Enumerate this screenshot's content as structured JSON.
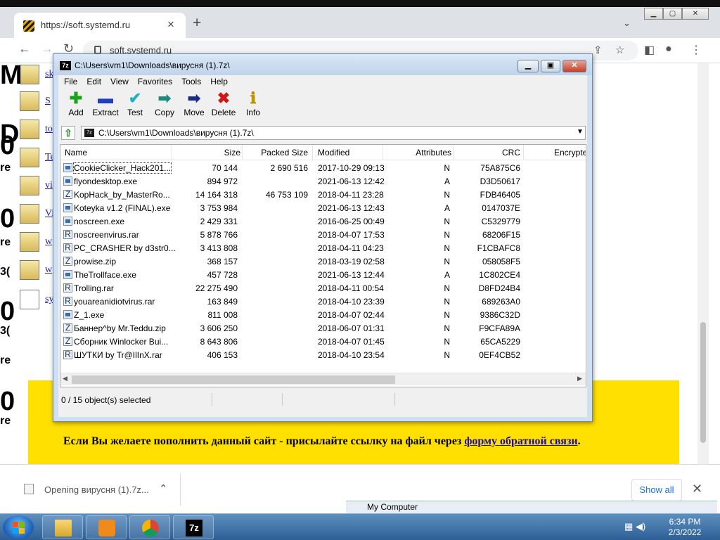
{
  "browser": {
    "tab_title": "https://soft.systemd.ru",
    "url": "soft.systemd.ru",
    "new_tab_symbol": "+",
    "close_symbol": "×"
  },
  "page": {
    "side_links": [
      "sk",
      "S",
      "to",
      "Te",
      "vi",
      "Vi",
      "w",
      "w",
      "sy"
    ],
    "big_left_chars": [
      "M",
      "D",
      "0",
      "re",
      "0",
      "re",
      "3(",
      "0",
      "3(",
      "re",
      "0",
      "re"
    ],
    "banner_text": "Если Вы желаете пополнить данный сайт - присылайте ссылку на файл через",
    "banner_link": "форму обратной связи",
    "banner_end": "."
  },
  "download_bar": {
    "item_text": "Opening вирусня (1).7z...",
    "show_all": "Show all"
  },
  "background_window": {
    "label": "My Computer"
  },
  "sevenzip": {
    "title": "C:\\Users\\vm1\\Downloads\\вирусня (1).7z\\",
    "logo": "7z",
    "menu": [
      "File",
      "Edit",
      "View",
      "Favorites",
      "Tools",
      "Help"
    ],
    "toolbar": [
      {
        "label": "Add",
        "icon": "plus-icon",
        "glyph": "✚",
        "color": "#1aa31a"
      },
      {
        "label": "Extract",
        "icon": "minus-icon",
        "glyph": "▬",
        "color": "#1f3fbf"
      },
      {
        "label": "Test",
        "icon": "check-icon",
        "glyph": "✔",
        "color": "#20b0c0"
      },
      {
        "label": "Copy",
        "icon": "copy-arrow-icon",
        "glyph": "➡",
        "color": "#1a8a7a"
      },
      {
        "label": "Move",
        "icon": "move-arrow-icon",
        "glyph": "➡",
        "color": "#1a2a8a"
      },
      {
        "label": "Delete",
        "icon": "delete-x-icon",
        "glyph": "✖",
        "color": "#d01818"
      },
      {
        "label": "Info",
        "icon": "info-icon",
        "glyph": "ℹ",
        "color": "#c09000"
      }
    ],
    "address": "C:\\Users\\vm1\\Downloads\\вирусня (1).7z\\",
    "columns": [
      "Name",
      "Size",
      "Packed Size",
      "Modified",
      "Attributes",
      "CRC",
      "Encrypte"
    ],
    "files": [
      {
        "name": "CookieClicker_Hack201...",
        "size": "70 144",
        "packed": "2 690 516",
        "modified": "2017-10-29 09:13",
        "attr": "N",
        "crc": "75A875C6",
        "type": "exe"
      },
      {
        "name": "flyondesktop.exe",
        "size": "894 972",
        "packed": "",
        "modified": "2021-06-13 12:42",
        "attr": "A",
        "crc": "D3D50617",
        "type": "exe"
      },
      {
        "name": "KopHack_by_MasterRo...",
        "size": "14 164 318",
        "packed": "46 753 109",
        "modified": "2018-04-11 23:28",
        "attr": "N",
        "crc": "FDB46405",
        "type": "zip"
      },
      {
        "name": "Koteyka v1.2 (FINAL).exe",
        "size": "3 753 984",
        "packed": "",
        "modified": "2021-06-13 12:43",
        "attr": "A",
        "crc": "0147037E",
        "type": "exe"
      },
      {
        "name": "noscreen.exe",
        "size": "2 429 331",
        "packed": "",
        "modified": "2016-06-25 00:49",
        "attr": "N",
        "crc": "C5329779",
        "type": "exe"
      },
      {
        "name": "noscreenvirus.rar",
        "size": "5 878 766",
        "packed": "",
        "modified": "2018-04-07 17:53",
        "attr": "N",
        "crc": "68206F15",
        "type": "rar"
      },
      {
        "name": "PC_CRASHER by d3str0...",
        "size": "3 413 808",
        "packed": "",
        "modified": "2018-04-11 04:23",
        "attr": "N",
        "crc": "F1CBAFC8",
        "type": "rar"
      },
      {
        "name": "prowise.zip",
        "size": "368 157",
        "packed": "",
        "modified": "2018-03-19 02:58",
        "attr": "N",
        "crc": "058058F5",
        "type": "zip"
      },
      {
        "name": "TheTrollface.exe",
        "size": "457 728",
        "packed": "",
        "modified": "2021-06-13 12:44",
        "attr": "A",
        "crc": "1C802CE4",
        "type": "exe"
      },
      {
        "name": "Trolling.rar",
        "size": "22 275 490",
        "packed": "",
        "modified": "2018-04-11 00:54",
        "attr": "N",
        "crc": "D8FD24B4",
        "type": "rar"
      },
      {
        "name": "youareanidiotvirus.rar",
        "size": "163 849",
        "packed": "",
        "modified": "2018-04-10 23:39",
        "attr": "N",
        "crc": "689263A0",
        "type": "rar"
      },
      {
        "name": "Z_1.exe",
        "size": "811 008",
        "packed": "",
        "modified": "2018-04-07 02:44",
        "attr": "N",
        "crc": "9386C32D",
        "type": "exe"
      },
      {
        "name": "Баннер^by Mr.Teddu.zip",
        "size": "3 606 250",
        "packed": "",
        "modified": "2018-06-07 01:31",
        "attr": "N",
        "crc": "F9CFA89A",
        "type": "zip"
      },
      {
        "name": "Сборник Winlocker Bui...",
        "size": "8 643 806",
        "packed": "",
        "modified": "2018-04-07 01:45",
        "attr": "N",
        "crc": "65CA5229",
        "type": "zip"
      },
      {
        "name": "ШУТКИ by Tr@IlInX.rar",
        "size": "406 153",
        "packed": "",
        "modified": "2018-04-10 23:54",
        "attr": "N",
        "crc": "0EF4CB52",
        "type": "rar"
      }
    ],
    "status": "0 / 15 object(s) selected"
  },
  "taskbar": {
    "time": "6:34 PM",
    "date": "2/3/2022"
  }
}
